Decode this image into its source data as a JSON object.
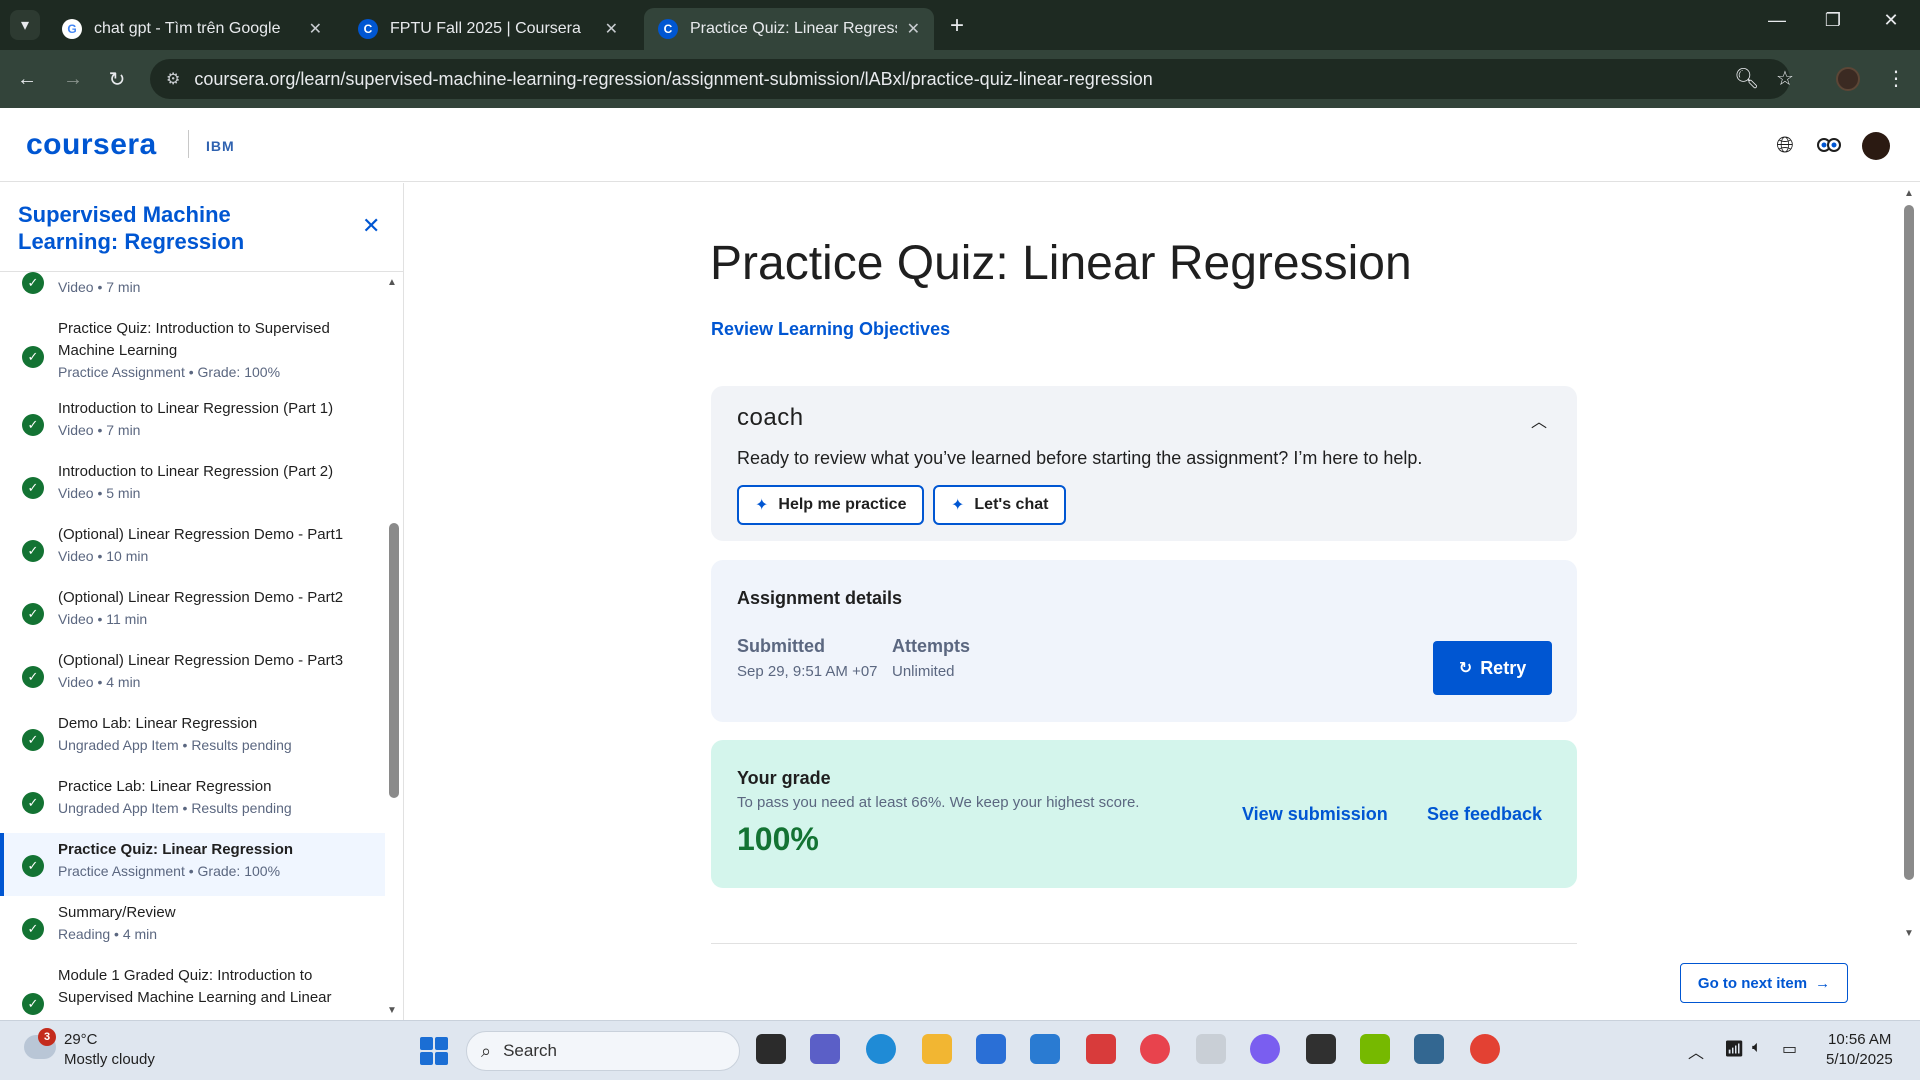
{
  "browser": {
    "tabs": [
      {
        "title": "chat gpt - Tìm trên Google",
        "favicon": "google-icon"
      },
      {
        "title": "FPTU Fall 2025 | Coursera",
        "favicon": "coursera-icon"
      },
      {
        "title": "Practice Quiz: Linear Regression",
        "favicon": "coursera-icon",
        "active": true
      }
    ],
    "url": "coursera.org/learn/supervised-machine-learning-regression/assignment-submission/lABxl/practice-quiz-linear-regression"
  },
  "header": {
    "logo": "coursera",
    "partner": "IBM"
  },
  "sidebar": {
    "title": "Supervised Machine Learning: Regression",
    "items": [
      {
        "name": "",
        "meta": "Video • 7 min"
      },
      {
        "name": "Practice Quiz: Introduction to Supervised Machine Learning",
        "meta": "Practice Assignment • Grade: 100%"
      },
      {
        "name": "Introduction to Linear Regression (Part 1)",
        "meta": "Video • 7 min"
      },
      {
        "name": "Introduction to Linear Regression (Part 2)",
        "meta": "Video • 5 min"
      },
      {
        "name": "(Optional) Linear Regression Demo - Part1",
        "meta": "Video • 10 min"
      },
      {
        "name": "(Optional) Linear Regression Demo - Part2",
        "meta": "Video • 11 min"
      },
      {
        "name": "(Optional) Linear Regression Demo - Part3",
        "meta": "Video • 4 min"
      },
      {
        "name": "Demo Lab: Linear Regression",
        "meta": "Ungraded App Item • Results pending"
      },
      {
        "name": "Practice Lab: Linear Regression",
        "meta": "Ungraded App Item • Results pending"
      },
      {
        "name": "Practice Quiz: Linear Regression",
        "meta": "Practice Assignment • Grade: 100%"
      },
      {
        "name": "Summary/Review",
        "meta": "Reading • 4 min"
      },
      {
        "name": "Module 1 Graded Quiz: Introduction to Supervised Machine Learning and Linear",
        "meta": ""
      }
    ]
  },
  "main": {
    "title": "Practice Quiz: Linear Regression",
    "objectives_link": "Review Learning Objectives",
    "coach": {
      "logo": "coach",
      "text": "Ready to review what you’ve learned before starting the assignment? I’m here to help.",
      "btn_practice": "Help me practice",
      "btn_chat": "Let's chat"
    },
    "details": {
      "title": "Assignment details",
      "submitted_label": "Submitted",
      "submitted_value": "Sep 29, 9:51 AM +07",
      "attempts_label": "Attempts",
      "attempts_value": "Unlimited",
      "retry": "Retry"
    },
    "grade": {
      "title": "Your grade",
      "note": "To pass you need at least 66%. We keep your highest score.",
      "value": "100%",
      "view_submission": "View submission",
      "see_feedback": "See feedback"
    },
    "next_item": "Go to next item"
  },
  "taskbar": {
    "weather_badge": "3",
    "temperature": "29°C",
    "weather": "Mostly cloudy",
    "search": "Search",
    "time": "10:56 AM",
    "date": "5/10/2025"
  },
  "colors": {
    "accent": "#0056d2",
    "success": "#137333",
    "grade_bg": "#d4f5ec"
  }
}
